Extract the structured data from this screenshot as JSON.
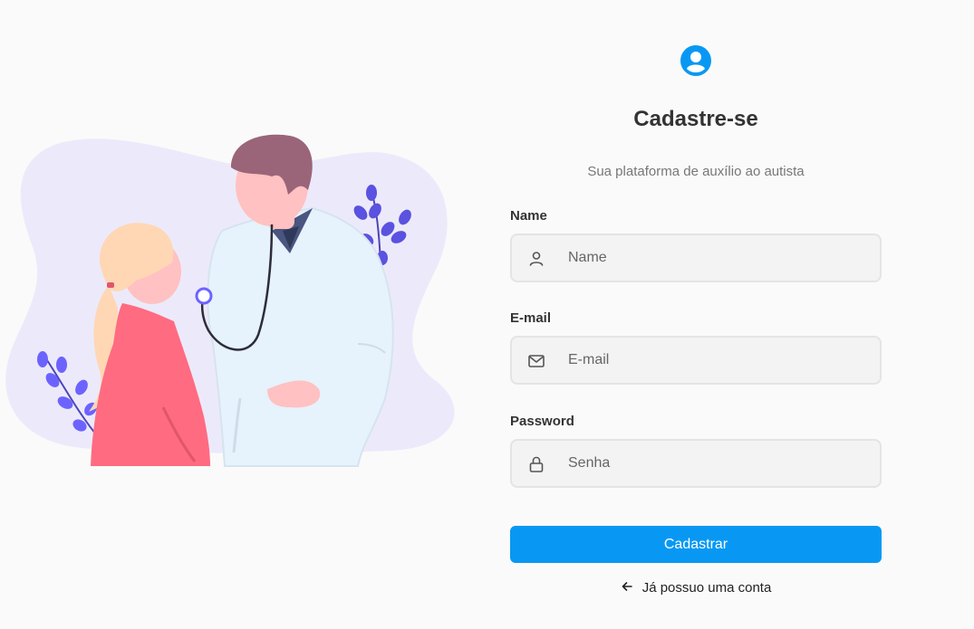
{
  "form": {
    "title": "Cadastre-se",
    "subtitle": "Sua plataforma de auxílio ao autista",
    "fields": [
      {
        "label": "Name",
        "placeholder": "Name",
        "icon": "user-icon"
      },
      {
        "label": "E-mail",
        "placeholder": "E-mail",
        "icon": "mail-icon"
      },
      {
        "label": "Password",
        "placeholder": "Senha",
        "icon": "lock-icon"
      }
    ],
    "submit_label": "Cadastrar",
    "login_link_label": "Já possuo uma conta",
    "login_link_icon": "arrow-left-icon"
  },
  "header_icon": "user-circle-icon",
  "illustration": "doctor-patient-illustration",
  "colors": {
    "primary": "#0898f3",
    "background": "#fafafa",
    "input_background": "#f3f3f3",
    "blob": "#eceafa",
    "accent_purple": "#6c63ff",
    "shirt_pink": "#ff6b81"
  }
}
